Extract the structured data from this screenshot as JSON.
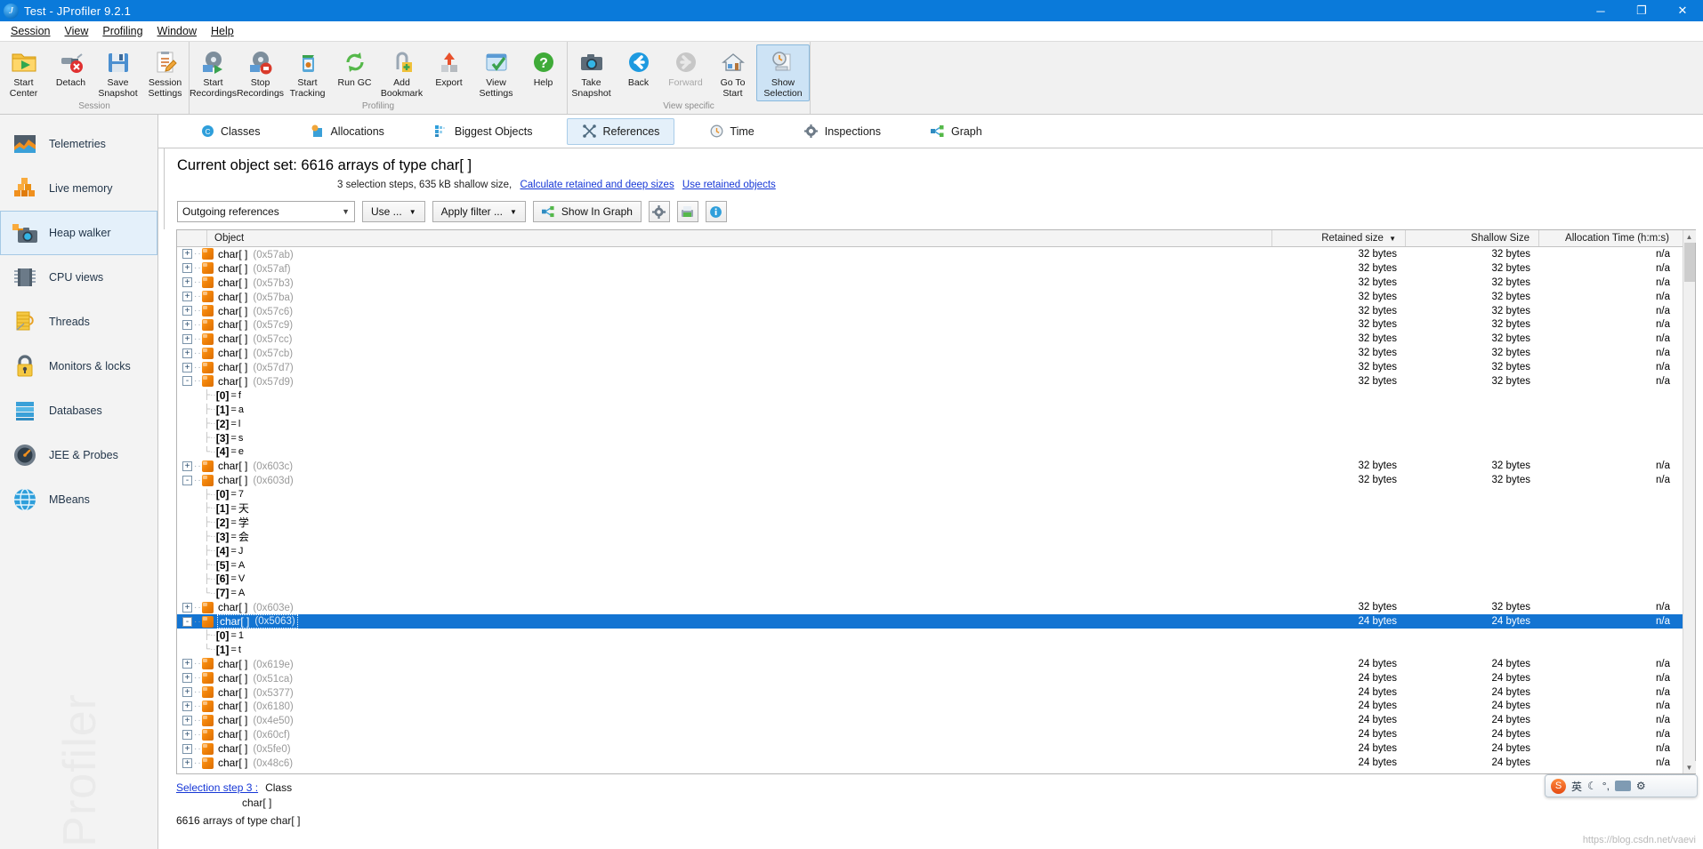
{
  "window": {
    "title": "Test - JProfiler 9.2.1",
    "app_icon": "jprofiler-icon",
    "minimize": "─",
    "maximize": "❐",
    "close": "✕"
  },
  "menubar": {
    "items": [
      "Session",
      "View",
      "Profiling",
      "Window",
      "Help"
    ]
  },
  "toolbar": {
    "groups": [
      {
        "label": "Session",
        "buttons": [
          {
            "label": "Start\nCenter",
            "icon": "start-center-icon",
            "state": "normal"
          },
          {
            "label": "Detach",
            "icon": "detach-icon",
            "state": "normal"
          },
          {
            "label": "Save\nSnapshot",
            "icon": "save-snapshot-icon",
            "state": "normal"
          },
          {
            "label": "Session\nSettings",
            "icon": "session-settings-icon",
            "state": "normal"
          }
        ]
      },
      {
        "label": "Profiling",
        "buttons": [
          {
            "label": "Start\nRecordings",
            "icon": "start-recordings-icon",
            "state": "normal"
          },
          {
            "label": "Stop\nRecordings",
            "icon": "stop-recordings-icon",
            "state": "normal"
          },
          {
            "label": "Start\nTracking",
            "icon": "start-tracking-icon",
            "state": "normal"
          },
          {
            "label": "Run GC",
            "icon": "run-gc-icon",
            "state": "normal"
          },
          {
            "label": "Add\nBookmark",
            "icon": "add-bookmark-icon",
            "state": "normal"
          },
          {
            "label": "Export",
            "icon": "export-icon",
            "state": "normal"
          },
          {
            "label": "View\nSettings",
            "icon": "view-settings-icon",
            "state": "normal"
          },
          {
            "label": "Help",
            "icon": "help-icon",
            "state": "normal"
          }
        ]
      },
      {
        "label": "View specific",
        "buttons": [
          {
            "label": "Take\nSnapshot",
            "icon": "take-snapshot-icon",
            "state": "normal"
          },
          {
            "label": "Back",
            "icon": "back-arrow-icon",
            "state": "normal"
          },
          {
            "label": "Forward",
            "icon": "forward-arrow-icon",
            "state": "disabled"
          },
          {
            "label": "Go To\nStart",
            "icon": "home-icon",
            "state": "normal"
          },
          {
            "label": "Show\nSelection",
            "icon": "show-selection-icon",
            "state": "active"
          }
        ]
      }
    ]
  },
  "sidebar": {
    "watermark": "Profiler",
    "items": [
      {
        "label": "Telemetries",
        "icon": "telemetries-icon",
        "active": false
      },
      {
        "label": "Live memory",
        "icon": "live-memory-icon",
        "active": false
      },
      {
        "label": "Heap walker",
        "icon": "heap-walker-icon",
        "active": true
      },
      {
        "label": "CPU views",
        "icon": "cpu-views-icon",
        "active": false
      },
      {
        "label": "Threads",
        "icon": "threads-icon",
        "active": false
      },
      {
        "label": "Monitors & locks",
        "icon": "monitors-locks-icon",
        "active": false
      },
      {
        "label": "Databases",
        "icon": "databases-icon",
        "active": false
      },
      {
        "label": "JEE & Probes",
        "icon": "jee-probes-icon",
        "active": false
      },
      {
        "label": "MBeans",
        "icon": "mbeans-icon",
        "active": false
      }
    ]
  },
  "view_tabs": [
    {
      "label": "Classes",
      "icon": "classes-icon",
      "active": false
    },
    {
      "label": "Allocations",
      "icon": "allocations-icon",
      "active": false
    },
    {
      "label": "Biggest Objects",
      "icon": "biggest-objects-icon",
      "active": false
    },
    {
      "label": "References",
      "icon": "references-icon",
      "active": true
    },
    {
      "label": "Time",
      "icon": "time-icon",
      "active": false
    },
    {
      "label": "Inspections",
      "icon": "inspections-icon",
      "active": false
    },
    {
      "label": "Graph",
      "icon": "graph-icon",
      "active": false
    }
  ],
  "object_set": {
    "title": "Current object set: 6616 arrays of type char[ ]",
    "sub_text": "3 selection steps, 635 kB shallow size,",
    "link_calculate": "Calculate retained and deep sizes",
    "link_use_retained": "Use retained objects"
  },
  "filter_bar": {
    "reference_mode": "Outgoing references",
    "use_button": "Use ...",
    "apply_filter_button": "Apply filter ...",
    "show_in_graph_button": "Show In Graph",
    "settings_icon": "gear-icon",
    "export_icon": "export-table-icon",
    "info_icon": "info-icon"
  },
  "table": {
    "columns": [
      "Object",
      "Retained size",
      "Shallow Size",
      "Allocation Time (h:m:s)"
    ],
    "sorted_column": "Retained size",
    "sort_direction": "desc",
    "rows": [
      {
        "kind": "object",
        "depth": 0,
        "twisty": "+",
        "name": "char[ ]",
        "addr": "(0x57ab)",
        "retained": "32 bytes",
        "shallow": "32 bytes",
        "alloc": "n/a",
        "selected": false
      },
      {
        "kind": "object",
        "depth": 0,
        "twisty": "+",
        "name": "char[ ]",
        "addr": "(0x57af)",
        "retained": "32 bytes",
        "shallow": "32 bytes",
        "alloc": "n/a",
        "selected": false
      },
      {
        "kind": "object",
        "depth": 0,
        "twisty": "+",
        "name": "char[ ]",
        "addr": "(0x57b3)",
        "retained": "32 bytes",
        "shallow": "32 bytes",
        "alloc": "n/a",
        "selected": false
      },
      {
        "kind": "object",
        "depth": 0,
        "twisty": "+",
        "name": "char[ ]",
        "addr": "(0x57ba)",
        "retained": "32 bytes",
        "shallow": "32 bytes",
        "alloc": "n/a",
        "selected": false
      },
      {
        "kind": "object",
        "depth": 0,
        "twisty": "+",
        "name": "char[ ]",
        "addr": "(0x57c6)",
        "retained": "32 bytes",
        "shallow": "32 bytes",
        "alloc": "n/a",
        "selected": false
      },
      {
        "kind": "object",
        "depth": 0,
        "twisty": "+",
        "name": "char[ ]",
        "addr": "(0x57c9)",
        "retained": "32 bytes",
        "shallow": "32 bytes",
        "alloc": "n/a",
        "selected": false
      },
      {
        "kind": "object",
        "depth": 0,
        "twisty": "+",
        "name": "char[ ]",
        "addr": "(0x57cc)",
        "retained": "32 bytes",
        "shallow": "32 bytes",
        "alloc": "n/a",
        "selected": false
      },
      {
        "kind": "object",
        "depth": 0,
        "twisty": "+",
        "name": "char[ ]",
        "addr": "(0x57cb)",
        "retained": "32 bytes",
        "shallow": "32 bytes",
        "alloc": "n/a",
        "selected": false
      },
      {
        "kind": "object",
        "depth": 0,
        "twisty": "+",
        "name": "char[ ]",
        "addr": "(0x57d7)",
        "retained": "32 bytes",
        "shallow": "32 bytes",
        "alloc": "n/a",
        "selected": false
      },
      {
        "kind": "object",
        "depth": 0,
        "twisty": "-",
        "name": "char[ ]",
        "addr": "(0x57d9)",
        "retained": "32 bytes",
        "shallow": "32 bytes",
        "alloc": "n/a",
        "selected": false
      },
      {
        "kind": "element",
        "depth": 1,
        "index": "[0]",
        "value": "f",
        "cjk": false
      },
      {
        "kind": "element",
        "depth": 1,
        "index": "[1]",
        "value": "a",
        "cjk": false
      },
      {
        "kind": "element",
        "depth": 1,
        "index": "[2]",
        "value": "l",
        "cjk": false
      },
      {
        "kind": "element",
        "depth": 1,
        "index": "[3]",
        "value": "s",
        "cjk": false
      },
      {
        "kind": "element",
        "depth": 1,
        "index": "[4]",
        "value": "e",
        "cjk": false,
        "last": true
      },
      {
        "kind": "object",
        "depth": 0,
        "twisty": "+",
        "name": "char[ ]",
        "addr": "(0x603c)",
        "retained": "32 bytes",
        "shallow": "32 bytes",
        "alloc": "n/a",
        "selected": false
      },
      {
        "kind": "object",
        "depth": 0,
        "twisty": "-",
        "name": "char[ ]",
        "addr": "(0x603d)",
        "retained": "32 bytes",
        "shallow": "32 bytes",
        "alloc": "n/a",
        "selected": false
      },
      {
        "kind": "element",
        "depth": 1,
        "index": "[0]",
        "value": "7",
        "cjk": false
      },
      {
        "kind": "element",
        "depth": 1,
        "index": "[1]",
        "value": "天",
        "cjk": true
      },
      {
        "kind": "element",
        "depth": 1,
        "index": "[2]",
        "value": "学",
        "cjk": true
      },
      {
        "kind": "element",
        "depth": 1,
        "index": "[3]",
        "value": "会",
        "cjk": true
      },
      {
        "kind": "element",
        "depth": 1,
        "index": "[4]",
        "value": "J",
        "cjk": false
      },
      {
        "kind": "element",
        "depth": 1,
        "index": "[5]",
        "value": "A",
        "cjk": false
      },
      {
        "kind": "element",
        "depth": 1,
        "index": "[6]",
        "value": "V",
        "cjk": false
      },
      {
        "kind": "element",
        "depth": 1,
        "index": "[7]",
        "value": "A",
        "cjk": false,
        "last": true
      },
      {
        "kind": "object",
        "depth": 0,
        "twisty": "+",
        "name": "char[ ]",
        "addr": "(0x603e)",
        "retained": "32 bytes",
        "shallow": "32 bytes",
        "alloc": "n/a",
        "selected": false
      },
      {
        "kind": "object",
        "depth": 0,
        "twisty": "-",
        "name": "char[ ]",
        "addr": "(0x5063)",
        "retained": "24 bytes",
        "shallow": "24 bytes",
        "alloc": "n/a",
        "selected": true
      },
      {
        "kind": "element",
        "depth": 1,
        "index": "[0]",
        "value": "1",
        "cjk": false
      },
      {
        "kind": "element",
        "depth": 1,
        "index": "[1]",
        "value": "t",
        "cjk": false,
        "last": true
      },
      {
        "kind": "object",
        "depth": 0,
        "twisty": "+",
        "name": "char[ ]",
        "addr": "(0x619e)",
        "retained": "24 bytes",
        "shallow": "24 bytes",
        "alloc": "n/a",
        "selected": false
      },
      {
        "kind": "object",
        "depth": 0,
        "twisty": "+",
        "name": "char[ ]",
        "addr": "(0x51ca)",
        "retained": "24 bytes",
        "shallow": "24 bytes",
        "alloc": "n/a",
        "selected": false
      },
      {
        "kind": "object",
        "depth": 0,
        "twisty": "+",
        "name": "char[ ]",
        "addr": "(0x5377)",
        "retained": "24 bytes",
        "shallow": "24 bytes",
        "alloc": "n/a",
        "selected": false
      },
      {
        "kind": "object",
        "depth": 0,
        "twisty": "+",
        "name": "char[ ]",
        "addr": "(0x6180)",
        "retained": "24 bytes",
        "shallow": "24 bytes",
        "alloc": "n/a",
        "selected": false
      },
      {
        "kind": "object",
        "depth": 0,
        "twisty": "+",
        "name": "char[ ]",
        "addr": "(0x4e50)",
        "retained": "24 bytes",
        "shallow": "24 bytes",
        "alloc": "n/a",
        "selected": false
      },
      {
        "kind": "object",
        "depth": 0,
        "twisty": "+",
        "name": "char[ ]",
        "addr": "(0x60cf)",
        "retained": "24 bytes",
        "shallow": "24 bytes",
        "alloc": "n/a",
        "selected": false
      },
      {
        "kind": "object",
        "depth": 0,
        "twisty": "+",
        "name": "char[ ]",
        "addr": "(0x5fe0)",
        "retained": "24 bytes",
        "shallow": "24 bytes",
        "alloc": "n/a",
        "selected": false
      },
      {
        "kind": "object",
        "depth": 0,
        "twisty": "+",
        "name": "char[ ]",
        "addr": "(0x48c6)",
        "retained": "24 bytes",
        "shallow": "24 bytes",
        "alloc": "n/a",
        "selected": false
      }
    ]
  },
  "bottom_panel": {
    "step_link": "Selection step 3 :",
    "step_kind": "Class",
    "step_detail": "char[ ]",
    "summary": "6616 arrays of type char[ ]"
  },
  "ime": {
    "logo": "S",
    "mode": "英",
    "moon_icon": "moon-icon",
    "punct": "°,",
    "keyboard_icon": "keyboard-icon",
    "toolbox_icon": "toolbox-icon"
  },
  "watermark_url": "https://blog.csdn.net/vaevi",
  "colors": {
    "titlebar": "#0a7ada",
    "selection": "#1374d2",
    "link": "#1637d6",
    "accent_orange": "#f08208",
    "toolbar_bg": "#f1f1f1",
    "sidebar_bg": "#f3f3f3"
  }
}
